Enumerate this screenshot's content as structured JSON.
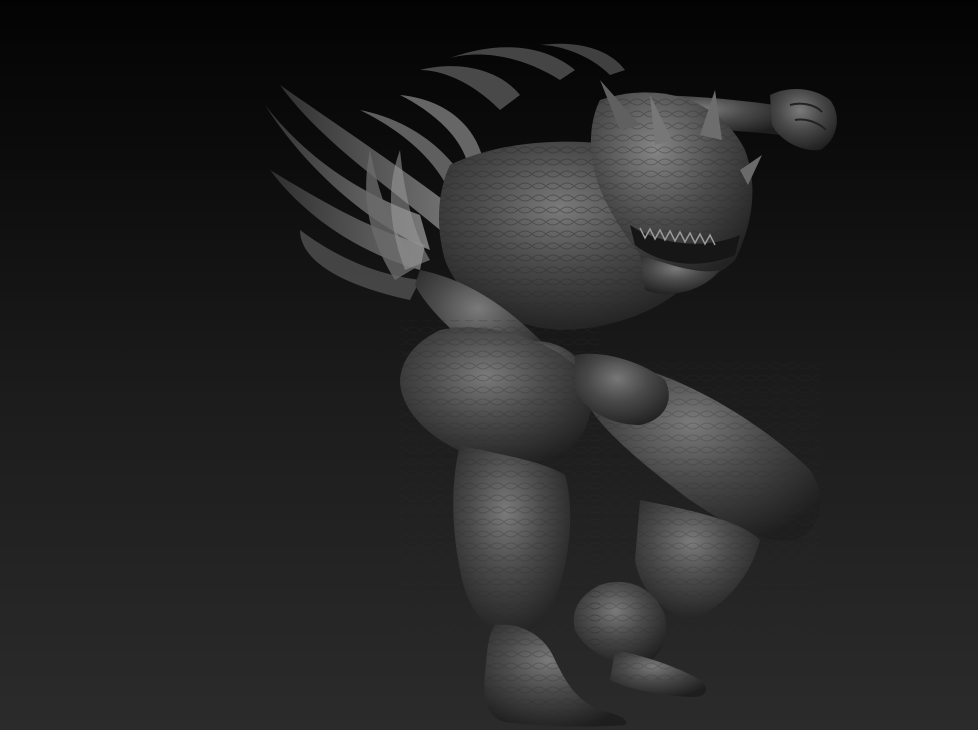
{
  "viewport": {
    "background_top": "#030303",
    "background_bottom": "#2b2b2b"
  },
  "model": {
    "material_color": "#4a4a4a",
    "highlight_color": "#8a8a8a",
    "shadow_color": "#1e1e1e"
  }
}
